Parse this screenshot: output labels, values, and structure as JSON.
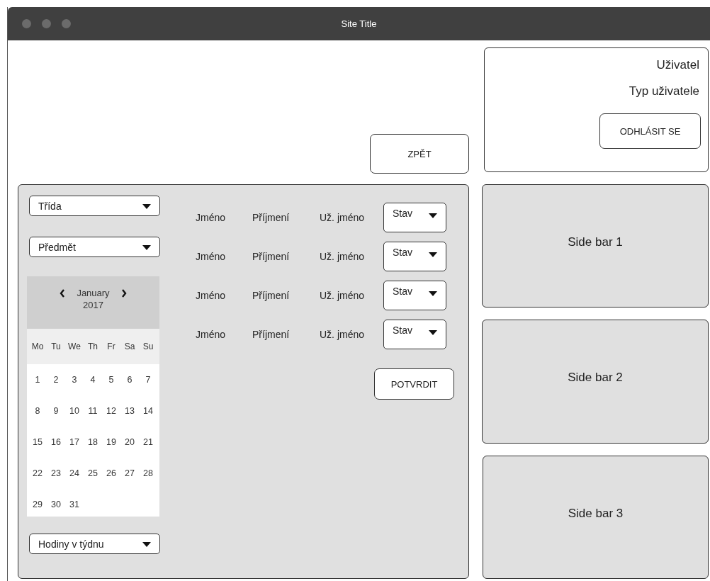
{
  "window": {
    "title": "Site Title"
  },
  "back_button": "ZPĚT",
  "user_card": {
    "name": "Uživatel",
    "type": "Typ uživatele",
    "logout_button": "ODHLÁSIT SE"
  },
  "filters": [
    {
      "label": "Třída"
    },
    {
      "label": "Předmět"
    }
  ],
  "calendar": {
    "month": "January",
    "year": "2017",
    "weekdays": [
      "Mo",
      "Tu",
      "We",
      "Th",
      "Fr",
      "Sa",
      "Su"
    ],
    "weeks": [
      [
        "1",
        "2",
        "3",
        "4",
        "5",
        "6",
        "7"
      ],
      [
        "8",
        "9",
        "10",
        "11",
        "12",
        "13",
        "14"
      ],
      [
        "15",
        "16",
        "17",
        "18",
        "19",
        "20",
        "21"
      ],
      [
        "22",
        "23",
        "24",
        "25",
        "26",
        "27",
        "28"
      ],
      [
        "29",
        "30",
        "31"
      ]
    ]
  },
  "hours_select": {
    "label": "Hodiny v týdnu"
  },
  "students": [
    {
      "first_name": "Jméno",
      "last_name": "Příjmení",
      "username": "Už. jméno",
      "status": "Stav"
    },
    {
      "first_name": "Jméno",
      "last_name": "Příjmení",
      "username": "Už. jméno",
      "status": "Stav"
    },
    {
      "first_name": "Jméno",
      "last_name": "Příjmení",
      "username": "Už. jméno",
      "status": "Stav"
    },
    {
      "first_name": "Jméno",
      "last_name": "Příjmení",
      "username": "Už. jméno",
      "status": "Stav"
    }
  ],
  "confirm_button": "POTVRDIT",
  "sidebars": [
    "Side bar 1",
    "Side bar 2",
    "Side bar 3"
  ]
}
